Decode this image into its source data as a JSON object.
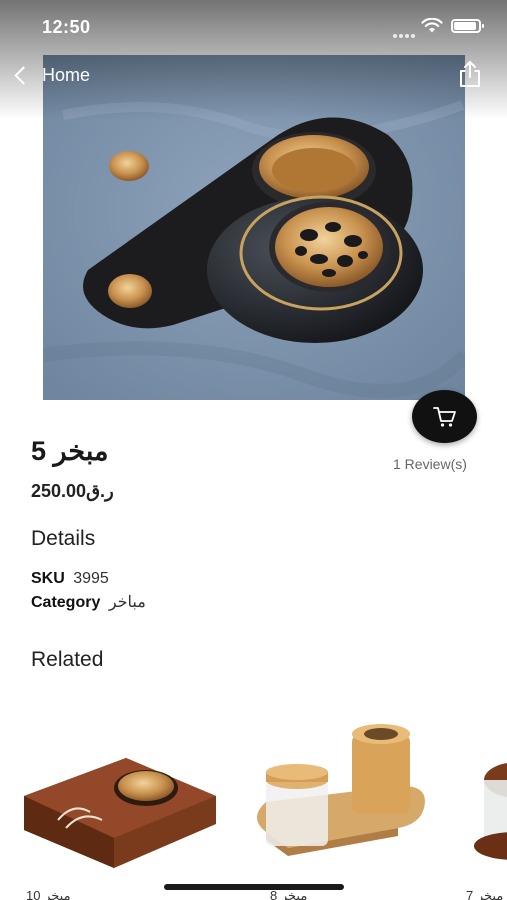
{
  "status_bar": {
    "time": "12:50"
  },
  "nav": {
    "back_label": "Home"
  },
  "product": {
    "title": "مبخر 5",
    "reviews": "1 Review(s)",
    "price": "250.00ر.ق"
  },
  "details": {
    "heading": "Details",
    "sku_label": "SKU",
    "sku_value": "3995",
    "category_label": "Category",
    "category_value": "مباخر"
  },
  "related": {
    "heading": "Related",
    "items": [
      {
        "name": "مبخر 10"
      },
      {
        "name": "مبخر 8"
      },
      {
        "name": "مبخر 7"
      }
    ]
  },
  "icons": {
    "back": "chevron-left-icon",
    "share": "share-icon",
    "cart": "cart-icon",
    "wifi": "wifi-icon",
    "battery": "battery-icon"
  },
  "colors": {
    "fab": "#111111",
    "text": "#1a1a1a"
  }
}
